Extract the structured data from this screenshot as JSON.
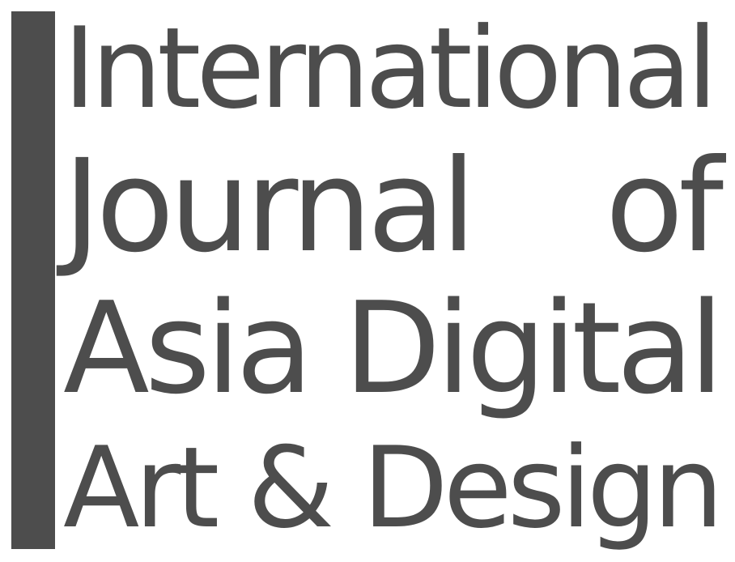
{
  "logo": {
    "lines": [
      "International",
      "Journal of",
      "Asia Digital",
      "Art & Design"
    ],
    "colors": {
      "text": "#4d4d4d",
      "bar": "#4d4d4d",
      "background": "#ffffff"
    }
  }
}
